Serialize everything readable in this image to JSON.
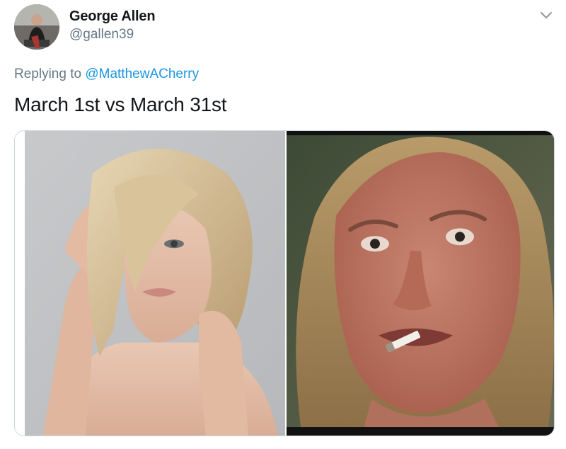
{
  "author": {
    "display_name": "George Allen",
    "handle": "@gallen39",
    "avatar_icon": "user-avatar-photo"
  },
  "reply_context": {
    "prefix": "Replying to",
    "mention": "@MatthewACherry"
  },
  "tweet": {
    "text": "March 1st vs March 31st"
  },
  "media": {
    "photos": [
      {
        "name": "glamour-portrait-photo"
      },
      {
        "name": "disheveled-portrait-photo"
      }
    ]
  },
  "icons": {
    "more": "chevron-down-icon"
  },
  "colors": {
    "link": "#1b95e0",
    "secondary_text": "#657786",
    "primary_text": "#14171a",
    "border": "#ccd6dd"
  }
}
